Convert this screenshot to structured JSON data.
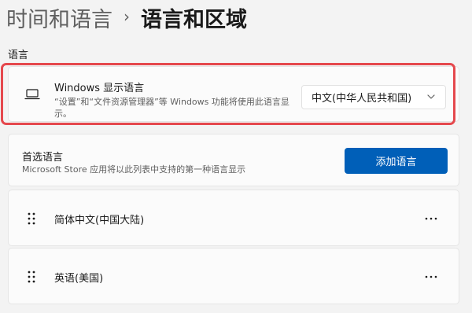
{
  "breadcrumb": {
    "parent": "时间和语言",
    "separator": "›",
    "current": "语言和区域"
  },
  "section": {
    "language_label": "语言"
  },
  "display_language": {
    "title": "Windows 显示语言",
    "description": "“设置”和“文件资源管理器”等 Windows 功能将使用此语言显示。",
    "selected": "中文(中华人民共和国)",
    "icon": "monitor-icon"
  },
  "preferred_languages": {
    "title": "首选语言",
    "subtitle": "Microsoft Store 应用将以此列表中支持的第一种语言显示",
    "add_button_label": "添加语言",
    "items": [
      {
        "name": "简体中文(中国大陆)"
      },
      {
        "name": "英语(美国)"
      }
    ]
  },
  "colors": {
    "accent": "#005fb8",
    "highlight": "#e5484d",
    "background": "#f3f3f3"
  }
}
